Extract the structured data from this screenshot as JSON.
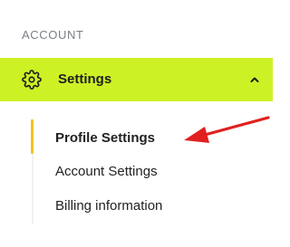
{
  "sidebar": {
    "section_label": "ACCOUNT",
    "settings": {
      "label": "Settings",
      "icon": "gear-icon",
      "expand_icon": "chevron-up-icon",
      "expanded": true,
      "background_color": "#ccf226"
    },
    "submenu": [
      {
        "label": "Profile Settings",
        "active": true
      },
      {
        "label": "Account Settings",
        "active": false
      },
      {
        "label": "Billing information",
        "active": false
      }
    ],
    "active_indicator_color": "#f2c21b"
  },
  "annotation": {
    "icon": "red-arrow-icon",
    "color": "#e0201f"
  }
}
